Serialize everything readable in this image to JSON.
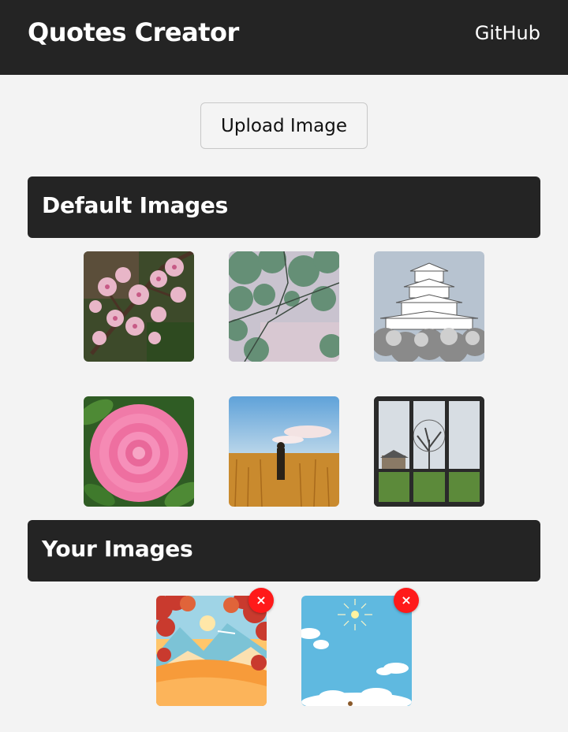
{
  "header": {
    "title": "Quotes Creator",
    "github_label": "GitHub"
  },
  "upload": {
    "label": "Upload Image"
  },
  "sections": {
    "default_title": "Default Images",
    "yours_title": "Your Images"
  },
  "default_images": [
    {
      "subject": "cherry-blossom"
    },
    {
      "subject": "tree-canopy"
    },
    {
      "subject": "castle-cherry-trees"
    },
    {
      "subject": "pink-camellia"
    },
    {
      "subject": "wheat-field-person"
    },
    {
      "subject": "window-tree-view"
    }
  ],
  "user_images": [
    {
      "subject": "autumn-landscape-illustration",
      "remove_label": "×"
    },
    {
      "subject": "sky-clouds-sun-illustration",
      "remove_label": "×"
    }
  ],
  "colors": {
    "header_bg": "#242424",
    "page_bg": "#f3f3f3",
    "remove_button": "#ff1a1a"
  }
}
